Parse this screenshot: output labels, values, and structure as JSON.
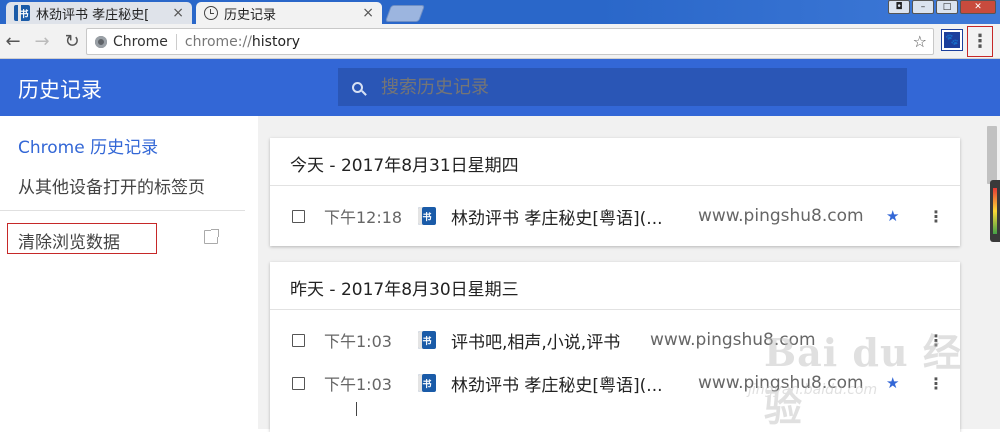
{
  "tabs": [
    {
      "title": "林劲评书 孝庄秘史[",
      "favicon": "pingshu-favicon",
      "active": false
    },
    {
      "title": "历史记录",
      "favicon": "history-clock-icon",
      "active": true
    }
  ],
  "toolbar": {
    "back": "←",
    "forward": "→",
    "reload": "↻",
    "chip": "Chrome",
    "url_scheme": "chrome://",
    "url_host": "history",
    "star": "☆",
    "ext": "🐾",
    "menu": "⋮"
  },
  "header": {
    "title": "历史记录",
    "search_placeholder": "搜索历史记录"
  },
  "sidebar": {
    "items": [
      {
        "label": "Chrome 历史记录",
        "active": true
      },
      {
        "label": "从其他设备打开的标签页",
        "active": false
      }
    ],
    "clear_label": "清除浏览数据"
  },
  "groups": [
    {
      "title": "今天 - 2017年8月31日星期四",
      "entries": [
        {
          "time": "下午12:18",
          "title": "林劲评书 孝庄秘史[粤语](...",
          "domain": "www.pingshu8.com",
          "starred": true
        }
      ]
    },
    {
      "title": "昨天 - 2017年8月30日星期三",
      "entries": [
        {
          "time": "下午1:03",
          "title": "评书吧,相声,小说,评书",
          "domain": "www.pingshu8.com",
          "starred": false
        },
        {
          "time": "下午1:03",
          "title": "林劲评书 孝庄秘史[粤语](...",
          "domain": "www.pingshu8.com",
          "starred": true
        }
      ]
    }
  ],
  "icons": {
    "star": "★",
    "more": "⋮",
    "tab_close": "×"
  },
  "watermark": {
    "logo": "Bai du 经验",
    "sub": "jingyan.baidu.com"
  },
  "colors": {
    "header": "#3367d6",
    "search": "#2a56b6",
    "accent": "#3367d6",
    "highlight_box": "#c62828"
  }
}
